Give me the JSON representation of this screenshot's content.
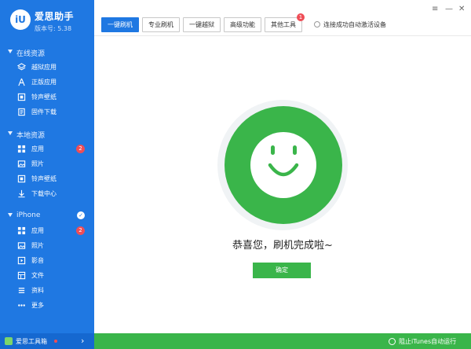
{
  "brand": {
    "logo_glyph": "iU",
    "name": "爱思助手",
    "version": "版本号: 5.38"
  },
  "sidebar": {
    "online": {
      "title": "在线资源",
      "items": [
        {
          "label": "越狱应用",
          "icon": "layers-icon"
        },
        {
          "label": "正版应用",
          "icon": "app-store-icon"
        },
        {
          "label": "铃声壁纸",
          "icon": "ringtone-icon"
        },
        {
          "label": "固件下载",
          "icon": "firmware-icon"
        }
      ]
    },
    "local": {
      "title": "本地资源",
      "items": [
        {
          "label": "应用",
          "icon": "grid-icon",
          "badge": "2"
        },
        {
          "label": "照片",
          "icon": "photo-icon"
        },
        {
          "label": "铃声壁纸",
          "icon": "ringtone-icon"
        },
        {
          "label": "下载中心",
          "icon": "download-icon"
        }
      ]
    },
    "iphone": {
      "title": "iPhone",
      "items": [
        {
          "label": "应用",
          "icon": "grid-icon",
          "badge": "2"
        },
        {
          "label": "照片",
          "icon": "photo-icon"
        },
        {
          "label": "影音",
          "icon": "music-icon"
        },
        {
          "label": "文件",
          "icon": "file-icon"
        },
        {
          "label": "资料",
          "icon": "list-icon"
        },
        {
          "label": "更多",
          "icon": "more-icon"
        }
      ]
    },
    "bottom": {
      "label": "爱思工具箱"
    }
  },
  "tabs": [
    {
      "label": "一键刷机",
      "active": true
    },
    {
      "label": "专业刷机"
    },
    {
      "label": "一键越狱"
    },
    {
      "label": "高级功能"
    },
    {
      "label": "其他工具",
      "badge": "1"
    }
  ],
  "auto_activate_label": "连接成功自动激活设备",
  "message": "恭喜您，刷机完成啦~",
  "confirm_label": "确定",
  "footer": {
    "itunes_label": "阻止iTunes自动运行"
  },
  "colors": {
    "sidebar": "#1f78e2",
    "accent_green": "#3ab54a",
    "badge_red": "#ef4d56"
  }
}
